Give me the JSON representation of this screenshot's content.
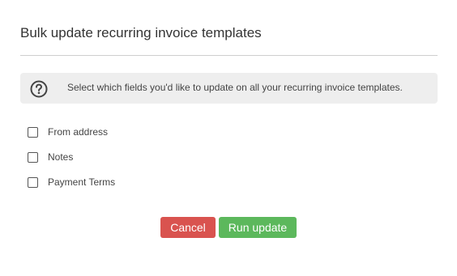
{
  "dialog": {
    "title": "Bulk update recurring invoice templates"
  },
  "info": {
    "icon": "question-circle-icon",
    "text": "Select which fields you'd like to update on all your recurring invoice templates."
  },
  "fields": [
    {
      "label": "From address",
      "checked": false
    },
    {
      "label": "Notes",
      "checked": false
    },
    {
      "label": "Payment Terms",
      "checked": false
    }
  ],
  "actions": {
    "cancel_label": "Cancel",
    "run_label": "Run update"
  },
  "colors": {
    "cancel": "#d9534f",
    "run": "#5cb85c",
    "info_background": "#eeeeee"
  }
}
